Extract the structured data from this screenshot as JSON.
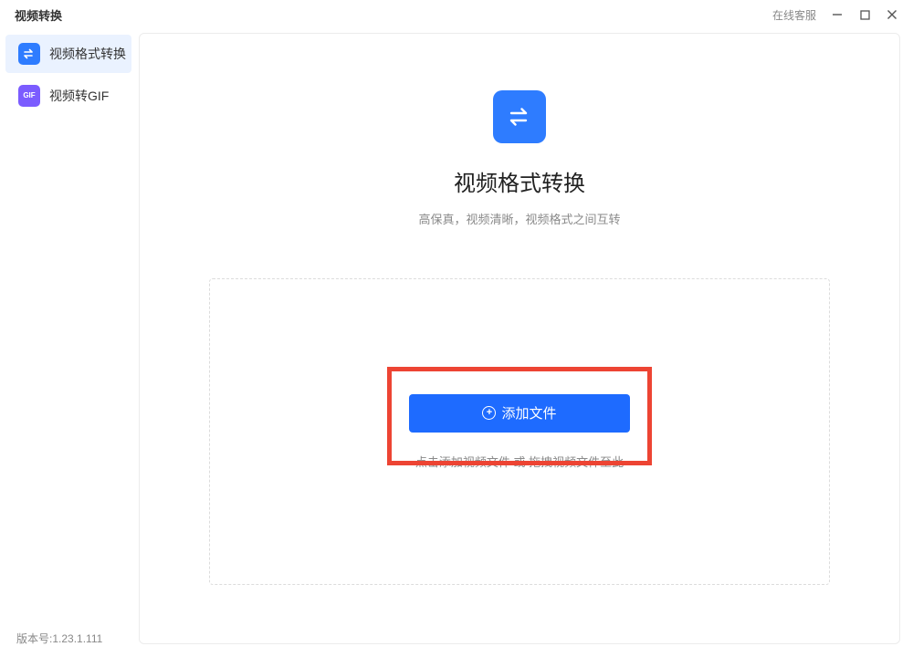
{
  "window": {
    "title": "视频转换",
    "online_service": "在线客服"
  },
  "sidebar": {
    "items": [
      {
        "label": "视频格式转换",
        "icon": "swap-icon",
        "active": true
      },
      {
        "label": "视频转GIF",
        "icon": "gif-icon",
        "active": false
      }
    ],
    "version_prefix": "版本号:",
    "version": "1.23.1.111"
  },
  "main": {
    "title": "视频格式转换",
    "subtitle": "高保真，视频清晰，视频格式之间互转",
    "add_button_label": "添加文件",
    "drop_hint": "点击添加视频文件 或 拖拽视频文件至此"
  },
  "colors": {
    "accent": "#2e7cff",
    "button": "#1e6bff",
    "highlight": "#ed4433",
    "purple": "#7b5cff"
  }
}
